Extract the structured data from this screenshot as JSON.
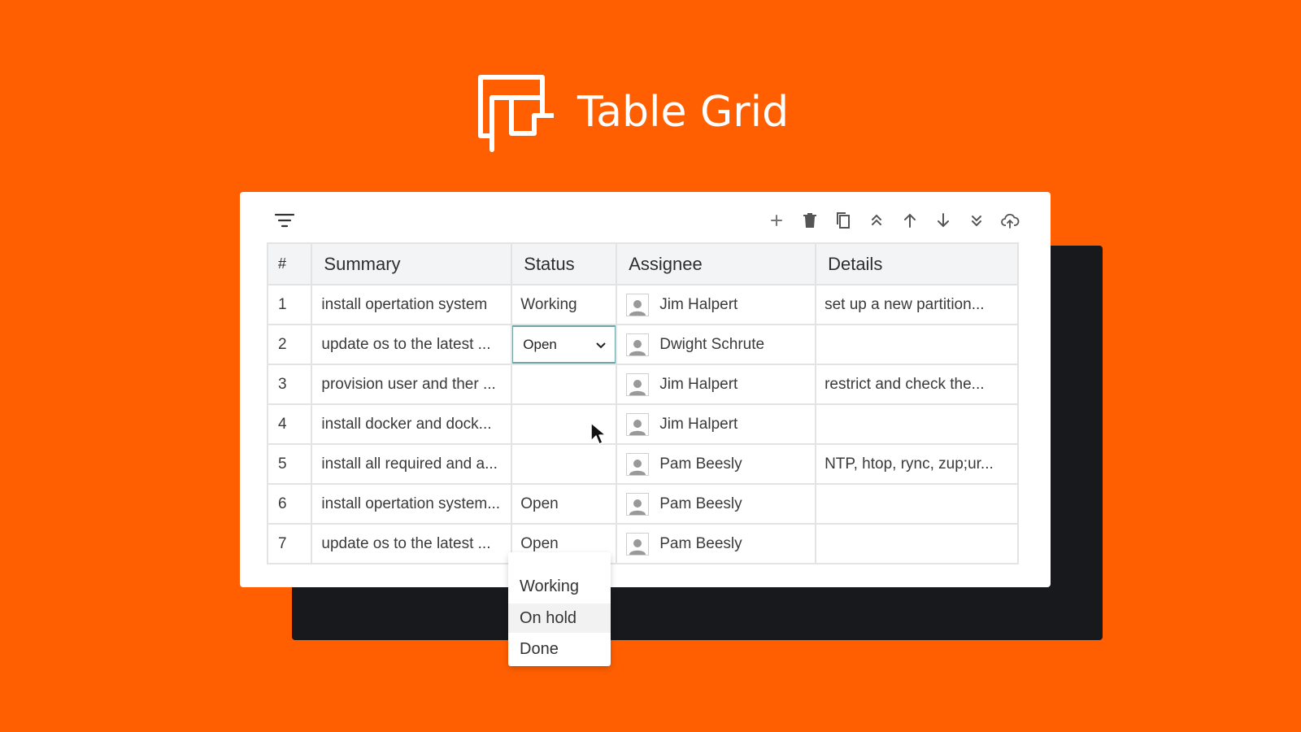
{
  "brand": {
    "title": "Table Grid"
  },
  "colors": {
    "background": "#FF5F00",
    "shadow": "#17191D",
    "card": "#FFFFFF",
    "editor_border": "#6FA5A5"
  },
  "toolbar": {
    "filter_icon": "filter-icon",
    "actions": [
      "add-icon",
      "delete-icon",
      "copy-icon",
      "move-top-icon",
      "move-up-icon",
      "move-down-icon",
      "move-bottom-icon",
      "upload-cloud-icon"
    ]
  },
  "table": {
    "headers": [
      "#",
      "Summary",
      "Status",
      "Assignee",
      "Details"
    ],
    "rows": [
      {
        "num": "1",
        "summary": "install opertation system",
        "status": "Working",
        "assignee": "Jim Halpert",
        "details": "set up a new partition..."
      },
      {
        "num": "2",
        "summary": "update os to the latest ...",
        "status": "Open",
        "assignee": "Dwight Schrute",
        "details": ""
      },
      {
        "num": "3",
        "summary": "provision user and ther ...",
        "status": "",
        "assignee": "Jim Halpert",
        "details": "restrict and check the..."
      },
      {
        "num": "4",
        "summary": "install docker and dock...",
        "status": "",
        "assignee": "Jim Halpert",
        "details": ""
      },
      {
        "num": "5",
        "summary": "install all required and a...",
        "status": "",
        "assignee": "Pam Beesly",
        "details": "NTP, htop, rync, zup;ur..."
      },
      {
        "num": "6",
        "summary": "install opertation system...",
        "status": "Open",
        "assignee": "Pam Beesly",
        "details": ""
      },
      {
        "num": "7",
        "summary": "update os to the latest ...",
        "status": "Open",
        "assignee": "Pam Beesly",
        "details": ""
      }
    ]
  },
  "status_dropdown": {
    "selected": "Open",
    "options": [
      "Working",
      "On hold",
      "Done"
    ],
    "hovered": "On hold"
  }
}
